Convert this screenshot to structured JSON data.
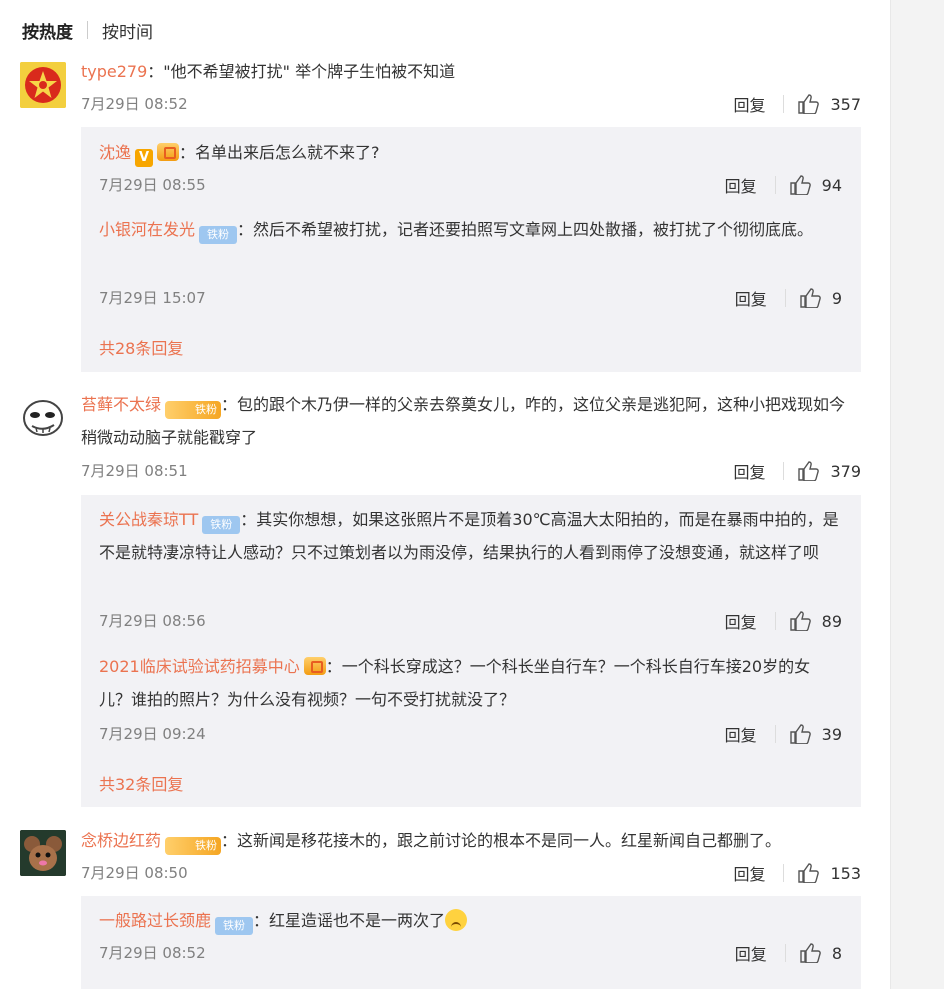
{
  "tabs": {
    "hot": "按热度",
    "time": "按时间"
  },
  "reply_label": "回复",
  "colors": {
    "username": "#eb7350",
    "reply_bg": "#f2f2f5",
    "time": "#808080"
  },
  "comments": [
    {
      "user": "type279",
      "text": "\"他不希望被打扰\" 举个牌子生怕被不知道",
      "time": "7月29日 08:52",
      "likes": "357",
      "avatar_icon": "red-star-badge-icon",
      "replies": [
        {
          "user": "沈逸",
          "text": "名单出来后怎么就不来了?",
          "time": "7月29日 08:55",
          "likes": "94"
        },
        {
          "user": "小银河在发光",
          "badge": "铁粉",
          "text": "然后不希望被打扰，记者还要拍照写文章网上四处散播，被打扰了个彻彻底底。",
          "time": "7月29日 15:07",
          "likes": "9"
        }
      ],
      "more": "共28条回复"
    },
    {
      "user": "苔藓不太绿",
      "badge": "铁粉",
      "text": "包的跟个木乃伊一样的父亲去祭奠女儿，咋的，这位父亲是逃犯阿，这种小把戏现如今稍微动动脑子就能戳穿了",
      "time": "7月29日 08:51",
      "likes": "379",
      "avatar_icon": "cartoon-face-icon",
      "replies": [
        {
          "user": "关公战秦琼TT",
          "badge": "铁粉",
          "text": "其实你想想，如果这张照片不是顶着30℃高温大太阳拍的，而是在暴雨中拍的，是不是就特凄凉特让人感动？只不过策划者以为雨没停，结果执行的人看到雨停了没想变通，就这样了呗",
          "time": "7月29日 08:56",
          "likes": "89"
        },
        {
          "user": "2021临床试验试药招募中心",
          "text": "一个科长穿成这？一个科长坐自行车？一个科长自行车接20岁的女儿？谁拍的照片？为什么没有视频？一句不受打扰就没了？",
          "time": "7月29日 09:24",
          "likes": "39"
        }
      ],
      "more": "共32条回复"
    },
    {
      "user": "念桥边红药",
      "badge": "铁粉",
      "text": "这新闻是移花接木的，跟之前讨论的根本不是同一人。红星新闻自己都删了。",
      "time": "7月29日 08:50",
      "likes": "153",
      "avatar_icon": "cartoon-mouse-icon",
      "replies": [
        {
          "user": "一般路过长颈鹿",
          "badge": "铁粉",
          "text": "红星造谣也不是一两次了",
          "time": "7月29日 08:52",
          "likes": "8"
        }
      ]
    }
  ]
}
